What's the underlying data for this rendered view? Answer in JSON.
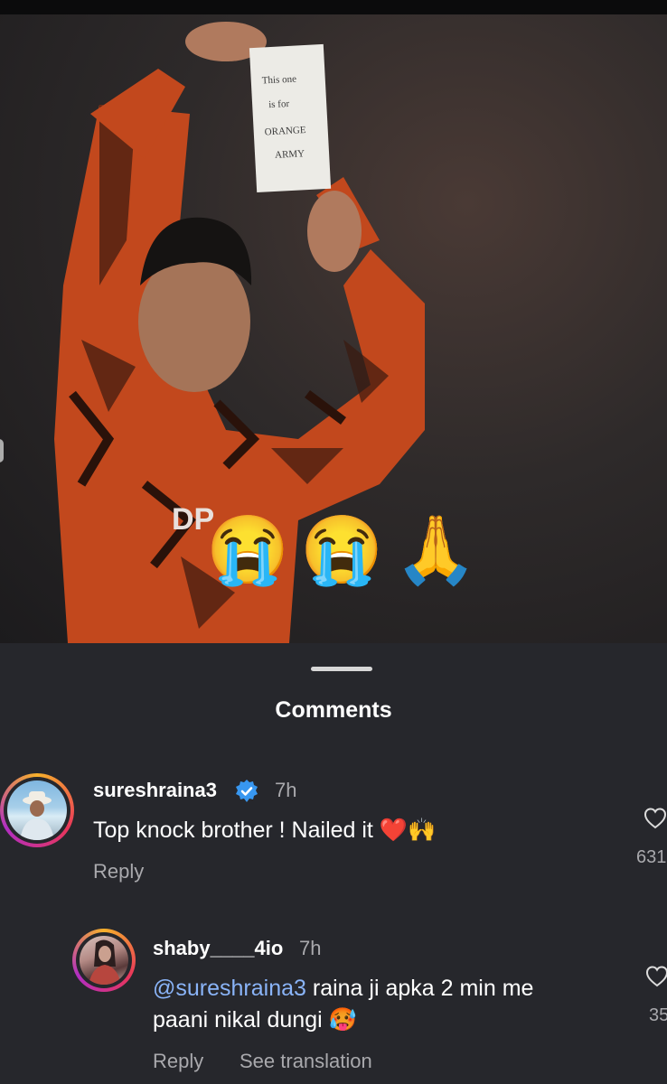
{
  "post": {
    "sign_text": [
      "This one",
      "is for",
      "ORANGE",
      "ARMY"
    ],
    "jersey_text": "DP",
    "emojis": [
      "😭",
      "😭",
      "🙏"
    ]
  },
  "sheet": {
    "title": "Comments"
  },
  "comments": [
    {
      "username": "sureshraina3",
      "verified": true,
      "time": "7h",
      "text": "Top knock brother ! Nailed it ❤️🙌",
      "reply_label": "Reply",
      "likes": "631"
    },
    {
      "username": "shaby____4io",
      "verified": false,
      "time": "7h",
      "mention": "@sureshraina3",
      "text_line1": " raina ji apka 2 min me",
      "text_line2": "paani nikal dungi 🥵",
      "reply_label": "Reply",
      "translate_label": "See translation",
      "likes": "35"
    }
  ]
}
